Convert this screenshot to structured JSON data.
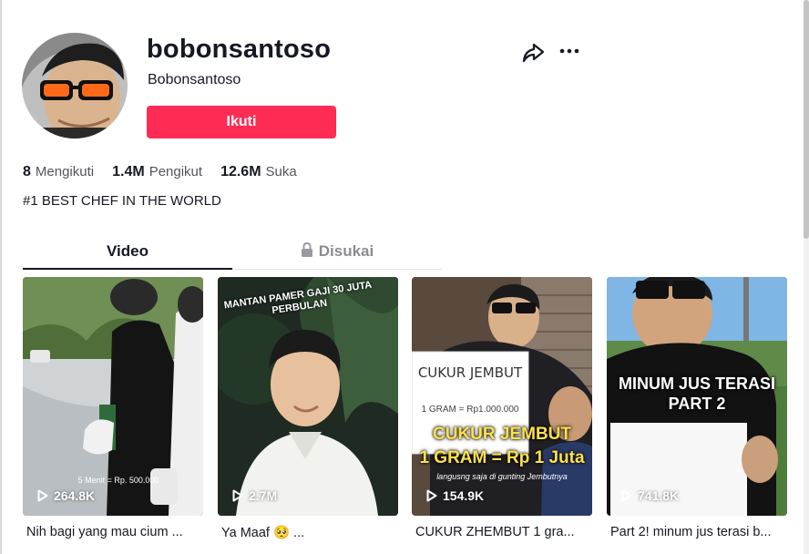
{
  "profile": {
    "username": "bobonsantoso",
    "nickname": "Bobonsantoso",
    "follow_label": "Ikuti",
    "bio": "#1 BEST CHEF IN THE WORLD"
  },
  "stats": [
    {
      "value": "8",
      "label": "Mengikuti"
    },
    {
      "value": "1.4M",
      "label": "Pengikut"
    },
    {
      "value": "12.6M",
      "label": "Suka"
    }
  ],
  "tabs": {
    "video": "Video",
    "liked": "Disukai",
    "active": "video"
  },
  "icons": {
    "share": "share-arrow-icon",
    "more": "more-dots-icon",
    "lock": "lock-icon",
    "play": "play-icon"
  },
  "colors": {
    "accent": "#fe2c55",
    "text": "#161823"
  },
  "videos": [
    {
      "views": "264.8K",
      "caption": "Nih bagi yang mau cium ...",
      "overlay_text": "5 Menit = Rp. 500.000"
    },
    {
      "views": "2.7M",
      "caption": "Ya Maaf 🥺 ...",
      "overlay_text": "MANTAN PAMER GAJI 30 JUTA PERBULAN"
    },
    {
      "views": "154.9K",
      "caption": "CUKUR ZHEMBUT 1 gra...",
      "overlay_title": "CUKUR JEMBUT",
      "overlay_subtitle": "1 GRAM = Rp 1 Juta",
      "overlay_small": "langusng saja di gunting Jembutnya",
      "sign_line1": "CUKUR JEMBUT",
      "sign_line2": "1 GRAM = Rp1.000.000"
    },
    {
      "views": "741.8K",
      "caption": "Part 2! minum jus terasi b...",
      "overlay_text": "MINUM JUS TERASI PART 2"
    }
  ]
}
